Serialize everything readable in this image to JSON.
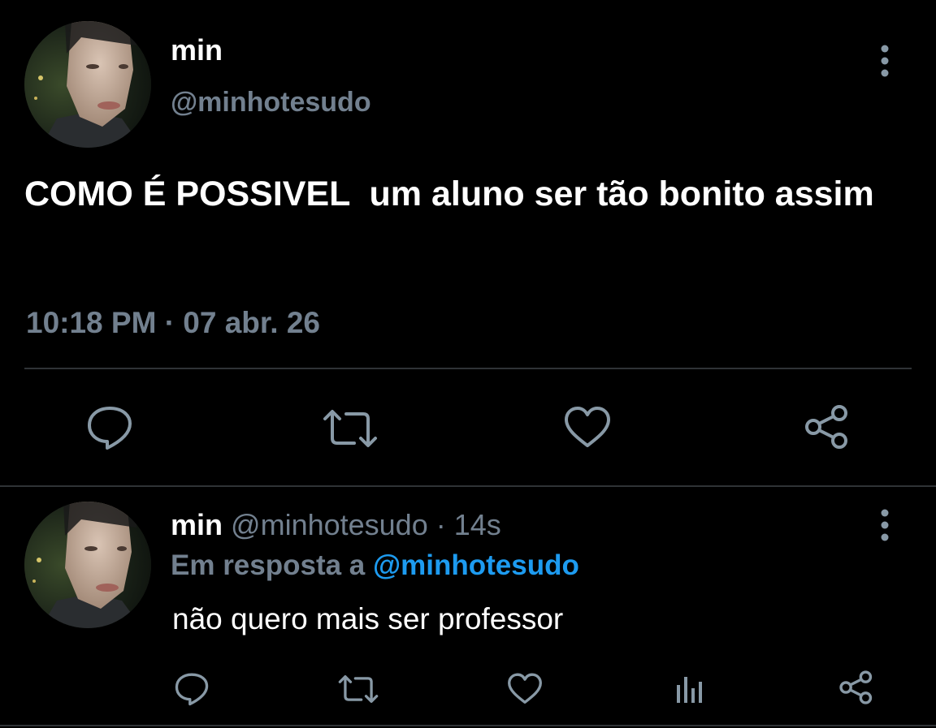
{
  "main_tweet": {
    "author": {
      "name": "min",
      "handle": "@minhotesudo",
      "avatar_icon": "profile-photo"
    },
    "text": "COMO É POSSIVEL  um aluno ser tão bonito assim",
    "timestamp": "10:18 PM · 07 abr. 26",
    "actions": [
      "reply-icon",
      "retweet-icon",
      "like-icon",
      "share-icon"
    ],
    "menu_icon": "more-vertical-icon"
  },
  "reply_tweet": {
    "author": {
      "name": "min",
      "handle": "@minhotesudo",
      "avatar_icon": "profile-photo"
    },
    "meta": "· 14s",
    "in_reply_to_label": "Em resposta a",
    "in_reply_to_handle": "@minhotesudo",
    "text": "não quero mais ser professor",
    "actions": [
      "reply-icon",
      "retweet-icon",
      "like-icon",
      "analytics-icon",
      "share-icon"
    ],
    "menu_icon": "more-vertical-icon"
  },
  "colors": {
    "background": "#000000",
    "primary_text": "#ffffff",
    "secondary_text": "#72808f",
    "icon": "#8899a6",
    "link": "#1d9bf0",
    "divider": "#2f3336"
  }
}
